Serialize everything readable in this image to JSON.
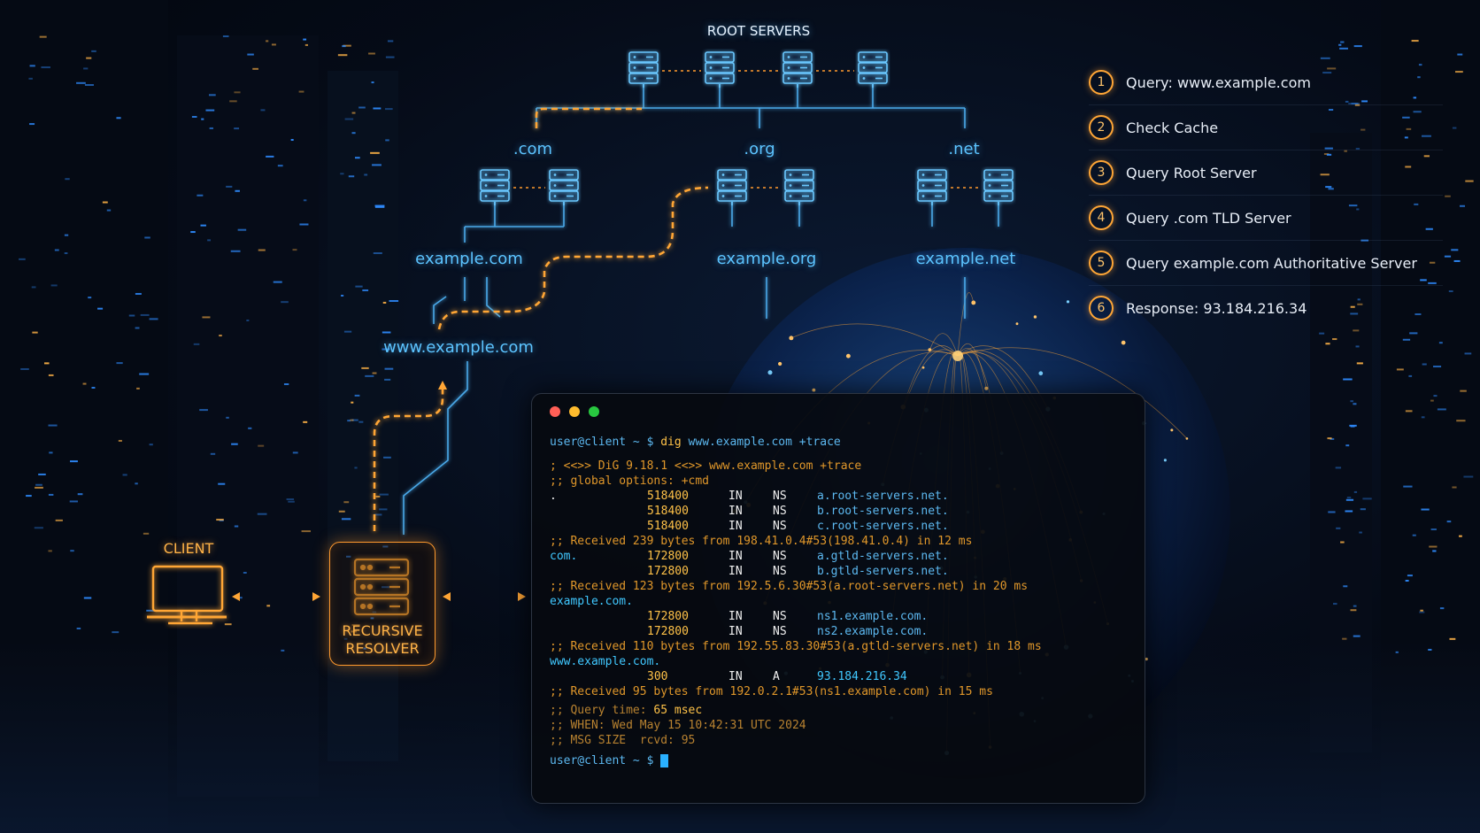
{
  "diagram": {
    "root_label": "ROOT SERVERS",
    "tld_labels": [
      ".com",
      ".org",
      ".net"
    ],
    "domain_labels": [
      "example.com",
      "example.org",
      "example.net"
    ],
    "host_label": "www.example.com",
    "client_label": "CLIENT",
    "resolver_label_line1": "RECURSIVE",
    "resolver_label_line2": "RESOLVER"
  },
  "steps": [
    {
      "num": "1",
      "text": "Query: www.example.com"
    },
    {
      "num": "2",
      "text": "Check Cache"
    },
    {
      "num": "3",
      "text": "Query Root Server"
    },
    {
      "num": "4",
      "text": "Query .com TLD Server"
    },
    {
      "num": "5",
      "text": "Query example.com Authoritative Server"
    },
    {
      "num": "6",
      "text": "Response: 93.184.216.34"
    }
  ],
  "terminal": {
    "prompt": "user@client ~ $",
    "command": "dig",
    "args": "www.example.com +trace",
    "header1": "; <<>> DiG 9.18.1 <<>> www.example.com +trace",
    "header2": ";; global options: +cmd",
    "root_records": [
      {
        "name": ".",
        "ttl": "518400",
        "cls": "IN",
        "type": "NS",
        "data": "a.root-servers.net."
      },
      {
        "name": "",
        "ttl": "518400",
        "cls": "IN",
        "type": "NS",
        "data": "b.root-servers.net."
      },
      {
        "name": "",
        "ttl": "518400",
        "cls": "IN",
        "type": "NS",
        "data": "c.root-servers.net."
      }
    ],
    "received1": ";; Received 239 bytes from 198.41.0.4#53(198.41.0.4) in 12 ms",
    "com_name": "com.",
    "com_records": [
      {
        "ttl": "172800",
        "cls": "IN",
        "type": "NS",
        "data": "a.gtld-servers.net."
      },
      {
        "ttl": "172800",
        "cls": "IN",
        "type": "NS",
        "data": "b.gtld-servers.net."
      }
    ],
    "received2": ";; Received 123 bytes from 192.5.6.30#53(a.root-servers.net) in 20 ms",
    "example_name": "example.com.",
    "example_records": [
      {
        "ttl": "172800",
        "cls": "IN",
        "type": "NS",
        "data": "ns1.example.com."
      },
      {
        "ttl": "172800",
        "cls": "IN",
        "type": "NS",
        "data": "ns2.example.com."
      }
    ],
    "received3": ";; Received 110 bytes from 192.55.83.30#53(a.gtld-servers.net) in 18 ms",
    "www_name": "www.example.com.",
    "www_record": {
      "ttl": "300",
      "cls": "IN",
      "type": "A",
      "data": "93.184.216.34"
    },
    "received4": ";; Received 95 bytes from 192.0.2.1#53(ns1.example.com) in 15 ms",
    "query_time_label": ";; Query time:",
    "query_time_value": "65 msec",
    "when_label": ";; WHEN:",
    "when_value": "Wed May 15 10:42:31 UTC 2024",
    "msg_size": ";; MSG SIZE  rcvd: 95",
    "final_prompt": "user@client ~ $"
  },
  "colors": {
    "accent_blue": "#5cc4ff",
    "accent_orange": "#ffa636",
    "terminal_bg": "#060a10"
  }
}
